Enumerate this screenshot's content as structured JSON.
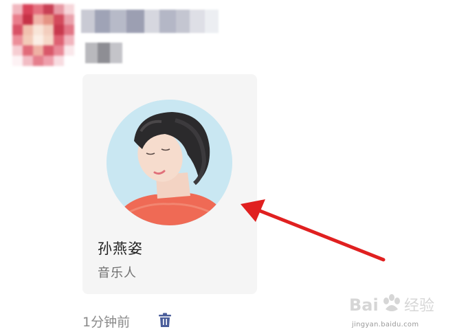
{
  "card": {
    "name": "孙燕姿",
    "role": "音乐人"
  },
  "message": {
    "timestamp": "1分钟前"
  },
  "icons": {
    "delete": "trash-icon"
  },
  "watermark": {
    "brand": "Baidu经验",
    "url": "jingyan.baidu.com"
  },
  "colors": {
    "arrow": "#e02020",
    "card_background": "#f5f5f5",
    "avatar_background": "#c9e7f2",
    "delete_icon": "#4a5d9a"
  }
}
